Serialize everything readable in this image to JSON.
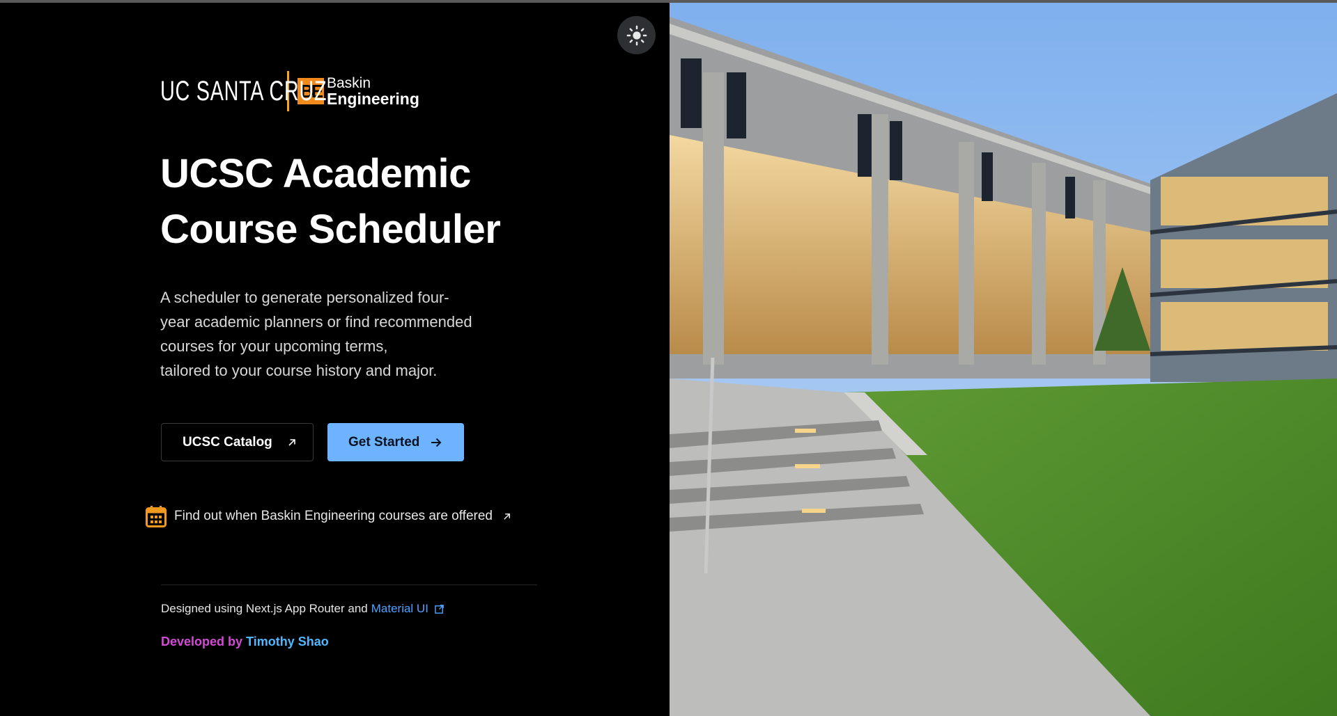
{
  "theme_toggle": {
    "icon": "sun-icon"
  },
  "logo": {
    "ucsc": "UC SANTA CRUZ",
    "be_mark": "BE",
    "be_line1": "Baskin",
    "be_line2": "Engineering"
  },
  "hero": {
    "title_line1": "UCSC Academic",
    "title_line2": "Course Scheduler",
    "description": [
      "A scheduler to generate personalized four-",
      "year academic planners or find recommended",
      "courses for your upcoming terms,",
      "tailored to your course history and major."
    ]
  },
  "buttons": {
    "catalog": "UCSC Catalog",
    "get_started": "Get Started"
  },
  "offered_link": "Find out when Baskin Engineering courses are offered",
  "footer": {
    "designed_prefix": "Designed using Next.js App Router and",
    "material_ui": "Material UI",
    "developed_by": "Developed by",
    "developer": "Timothy Shao"
  },
  "colors": {
    "accent_blue": "#6db3ff",
    "link_blue": "#4fa3ff",
    "orange": "#f08a1c",
    "magenta": "#d44ad6"
  }
}
